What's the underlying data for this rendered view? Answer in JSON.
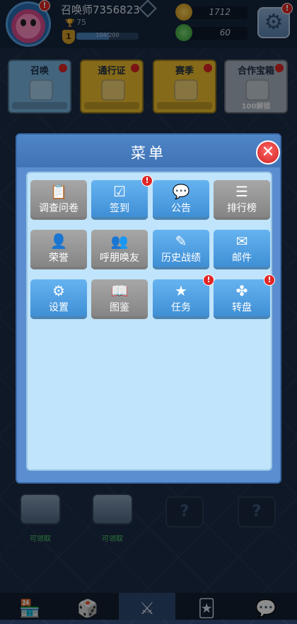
{
  "header": {
    "player_name": "召唤师7356823",
    "trophies": "75",
    "level": "1",
    "xp_text": "104/200",
    "xp_fraction": 0.52,
    "gold": "1712",
    "gems": "60",
    "avatar_badge": "!",
    "gear_badge": "!"
  },
  "cards": [
    {
      "label": "召唤",
      "color": "#7ab8e6",
      "foot": ""
    },
    {
      "label": "通行证",
      "color": "#f2c12e",
      "foot": ""
    },
    {
      "label": "赛季",
      "color": "#f2c12e",
      "foot": ""
    },
    {
      "label": "合作宝箱",
      "color": "#a9b6c4",
      "foot": "100解锁"
    }
  ],
  "modal": {
    "title": "菜单",
    "close_symbol": "✕"
  },
  "menu": [
    {
      "label": "调查问卷",
      "icon": "clipboard-icon",
      "glyph": "📋",
      "style": "gray",
      "badge": false
    },
    {
      "label": "签到",
      "icon": "checkbox-icon",
      "glyph": "☑",
      "style": "blue",
      "badge": true
    },
    {
      "label": "公告",
      "icon": "speech-bubble-icon",
      "glyph": "💬",
      "style": "blue",
      "badge": false
    },
    {
      "label": "排行榜",
      "icon": "list-icon",
      "glyph": "☰",
      "style": "gray",
      "badge": false
    },
    {
      "label": "荣誉",
      "icon": "user-star-icon",
      "glyph": "👤",
      "style": "gray",
      "badge": false
    },
    {
      "label": "呼朋唤友",
      "icon": "add-friend-icon",
      "glyph": "👥",
      "style": "gray",
      "badge": false
    },
    {
      "label": "历史战绩",
      "icon": "edit-icon",
      "glyph": "✎",
      "style": "blue",
      "badge": false
    },
    {
      "label": "邮件",
      "icon": "mail-icon",
      "glyph": "✉",
      "style": "blue",
      "badge": false
    },
    {
      "label": "设置",
      "icon": "gear-icon",
      "glyph": "⚙",
      "style": "blue",
      "badge": false
    },
    {
      "label": "图鉴",
      "icon": "book-icon",
      "glyph": "📖",
      "style": "gray",
      "badge": false
    },
    {
      "label": "任务",
      "icon": "star-icon",
      "glyph": "★",
      "style": "blue",
      "badge": true
    },
    {
      "label": "转盘",
      "icon": "wheel-icon",
      "glyph": "✤",
      "style": "blue",
      "badge": true
    }
  ],
  "menu_badge": "!",
  "chests": [
    {
      "label": "可领取"
    },
    {
      "label": "可领取"
    }
  ],
  "locked_slot_symbol": "?",
  "nav": [
    {
      "icon": "shop-icon",
      "glyph": "🏪"
    },
    {
      "icon": "dice-icon",
      "glyph": "🎲"
    },
    {
      "icon": "battle-icon",
      "glyph": "⚔"
    },
    {
      "icon": "cards-icon",
      "glyph": "🃏"
    },
    {
      "icon": "chat-icon",
      "glyph": "💬"
    }
  ]
}
